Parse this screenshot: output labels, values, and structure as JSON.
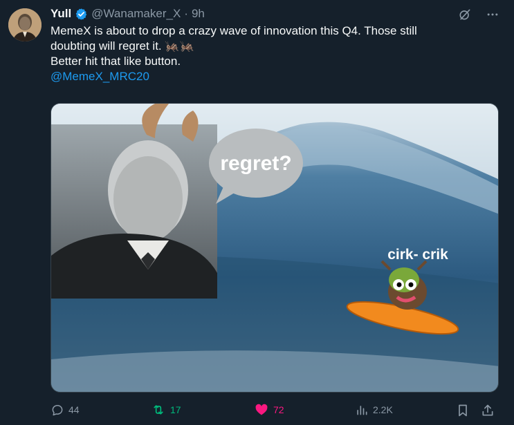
{
  "author": {
    "name": "Yull",
    "handle": "@Wanamaker_X",
    "separator": "·",
    "time": "9h"
  },
  "tweet": {
    "line1": "MemeX is about to drop a crazy wave of innovation this Q4. Those still",
    "line2": "doubting will regret it. 🦗🦗",
    "line3": "Better hit that like button.",
    "mention": "@MemeX_MRC20"
  },
  "media": {
    "bubble_text": "regret?",
    "caption": "cirk- crik"
  },
  "actions": {
    "replies": "44",
    "retweets": "17",
    "likes": "72",
    "views": "2.2K"
  },
  "colors": {
    "background": "#15202b",
    "text": "#f7f9f9",
    "secondary": "#8b98a5",
    "link": "#1d9bf0",
    "retweet": "#00ba7c",
    "like": "#f91880"
  },
  "icons": [
    "grok-icon",
    "more-icon",
    "verified-badge-icon",
    "reply-icon",
    "retweet-icon",
    "like-icon",
    "views-icon",
    "bookmark-icon",
    "share-icon"
  ]
}
